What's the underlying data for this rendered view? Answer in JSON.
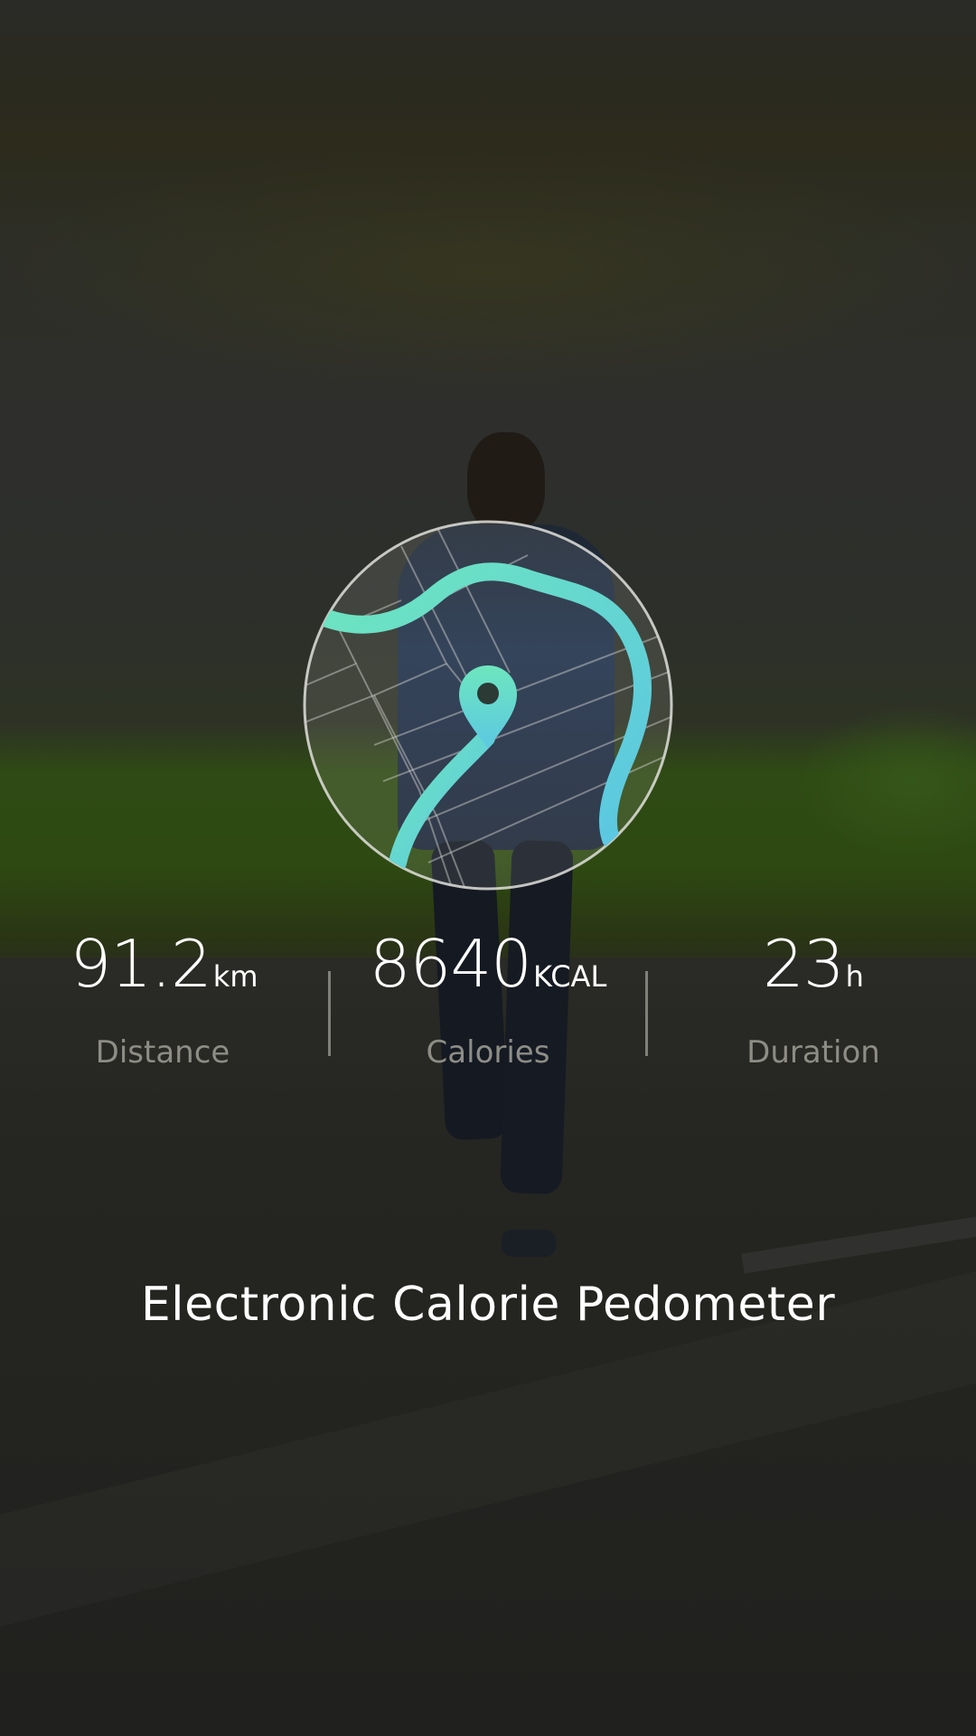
{
  "app": {
    "title": "Electronic Calorie Pedometer"
  },
  "stats": [
    {
      "value": "91.2",
      "unit": "km",
      "label": "Distance"
    },
    {
      "value": "8640",
      "unit": "KCAL",
      "label": "Calories"
    },
    {
      "value": "23",
      "unit": "h",
      "label": "Duration"
    }
  ],
  "map_badge": {
    "icon": "location-pin-icon",
    "route_color_start": "#6ee6be",
    "route_color_end": "#5bc6e3"
  }
}
